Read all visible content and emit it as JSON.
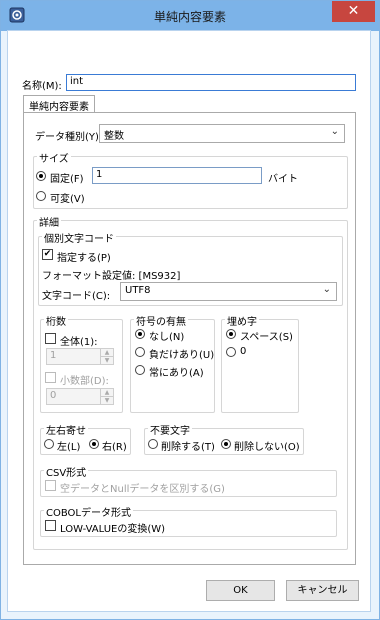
{
  "window": {
    "title": "単純内容要素",
    "close_label": "✕"
  },
  "name_field": {
    "label": "名称(M):",
    "value": "int"
  },
  "tab": {
    "label": "単純内容要素"
  },
  "data_type": {
    "label": "データ種別(Y):",
    "value": "整数"
  },
  "size": {
    "group_label": "サイズ",
    "fixed_label": "固定(F)",
    "fixed_value": "1",
    "unit_label": "バイト",
    "variable_label": "可変(V)"
  },
  "detail": {
    "group_label": "詳細",
    "encoding": {
      "group_label": "個別文字コード",
      "specify_label": "指定する(P)",
      "format_label": "フォーマット設定値: [MS932]",
      "charcode_label": "文字コード(C):",
      "charcode_value": "UTF8"
    },
    "digits": {
      "group_label": "桁数",
      "total_label": "全体(1):",
      "total_value": "1",
      "decimal_label": "小数部(D):",
      "decimal_value": "0"
    },
    "sign": {
      "group_label": "符号の有無",
      "none_label": "なし(N)",
      "negative_label": "負だけあり(U)",
      "always_label": "常にあり(A)"
    },
    "fill": {
      "group_label": "埋め字",
      "space_label": "スペース(S)",
      "zero_label": "0"
    },
    "align": {
      "group_label": "左右寄せ",
      "left_label": "左(L)",
      "right_label": "右(R)"
    },
    "unneeded": {
      "group_label": "不要文字",
      "delete_label": "削除する(T)",
      "keep_label": "削除しない(O)"
    },
    "csv": {
      "group_label": "CSV形式",
      "distinguish_label": "空データとNullデータを区別する(G)"
    },
    "cobol": {
      "group_label": "COBOLデータ形式",
      "lowvalue_label": "LOW-VALUEの変換(W)"
    }
  },
  "buttons": {
    "ok_label": "OK",
    "cancel_label": "キャンセル"
  }
}
